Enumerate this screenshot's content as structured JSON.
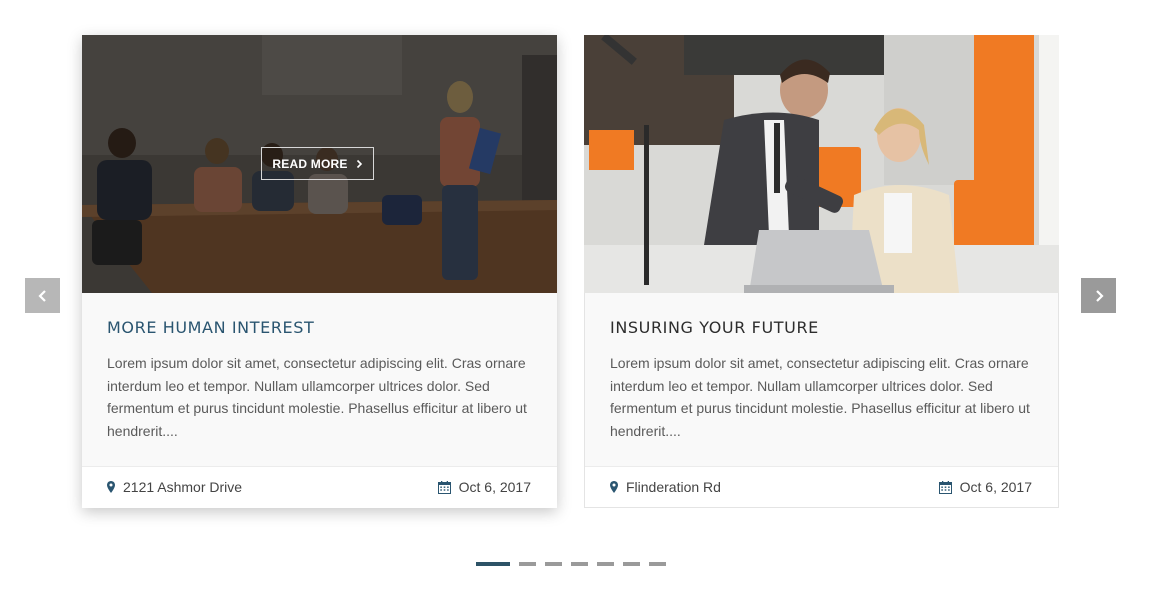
{
  "carousel": {
    "prev_icon": "chevron-left-icon",
    "next_icon": "chevron-right-icon",
    "pagination": {
      "total": 7,
      "active": 1
    }
  },
  "cards": [
    {
      "title": "MORE HUMAN INTEREST",
      "text": "Lorem ipsum dolor sit amet, consectetur adipiscing elit. Cras ornare interdum leo et tempor. Nullam ullamcorper ultrices dolor. Sed fermentum et purus tincidunt molestie. Phasellus efficitur at libero ut hendrerit....",
      "read_more": "READ MORE",
      "location": "2121 Ashmor Drive",
      "date": "Oct 6, 2017",
      "image": "classroom-meeting-photo"
    },
    {
      "title": "INSURING YOUR FUTURE",
      "text": "Lorem ipsum dolor sit amet, consectetur adipiscing elit. Cras ornare interdum leo et tempor. Nullam ullamcorper ultrices dolor. Sed fermentum et purus tincidunt molestie. Phasellus efficitur at libero ut hendrerit....",
      "location": "Flinderation Rd",
      "date": "Oct 6, 2017",
      "image": "office-laptop-photo"
    }
  ],
  "colors": {
    "accent": "#2a5570",
    "active_dot": "#2d5367",
    "inactive_dot": "#9a9a9a",
    "orange": "#f07a23"
  }
}
